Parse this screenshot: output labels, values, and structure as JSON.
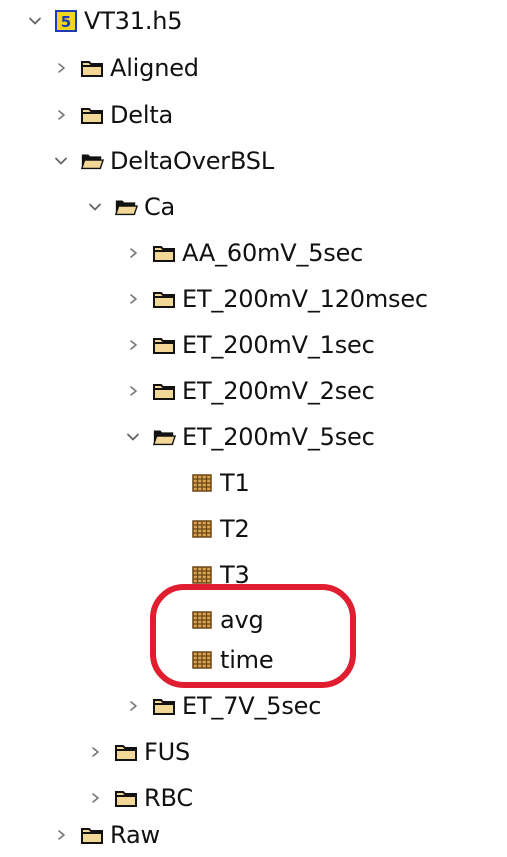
{
  "tree": {
    "root": {
      "label": "VT31.h5",
      "badge": "5",
      "expanded": true
    },
    "items": [
      {
        "label": "Aligned",
        "type": "folder",
        "expanded": false
      },
      {
        "label": "Delta",
        "type": "folder",
        "expanded": false
      },
      {
        "label": "DeltaOverBSL",
        "type": "folder",
        "expanded": true
      },
      {
        "label": "Ca",
        "type": "folder",
        "expanded": true
      },
      {
        "label": "AA_60mV_5sec",
        "type": "folder",
        "expanded": false
      },
      {
        "label": "ET_200mV_120msec",
        "type": "folder",
        "expanded": false
      },
      {
        "label": "ET_200mV_1sec",
        "type": "folder",
        "expanded": false
      },
      {
        "label": "ET_200mV_2sec",
        "type": "folder",
        "expanded": false
      },
      {
        "label": "ET_200mV_5sec",
        "type": "folder",
        "expanded": true
      },
      {
        "label": "T1",
        "type": "dataset"
      },
      {
        "label": "T2",
        "type": "dataset"
      },
      {
        "label": "T3",
        "type": "dataset"
      },
      {
        "label": "avg",
        "type": "dataset"
      },
      {
        "label": "time",
        "type": "dataset"
      },
      {
        "label": "ET_7V_5sec",
        "type": "folder",
        "expanded": false
      },
      {
        "label": "FUS",
        "type": "folder",
        "expanded": false
      },
      {
        "label": "RBC",
        "type": "folder",
        "expanded": false
      },
      {
        "label": "Raw",
        "type": "folder",
        "expanded": false
      }
    ]
  },
  "colors": {
    "folder_fill": "#f3d796",
    "folder_dark": "#121212",
    "dataset_fill": "#d9a34f",
    "dataset_grid": "#6a4516",
    "badge_fill": "#f2d423",
    "badge_text": "#1f3bb3",
    "highlight": "#e01e2f",
    "chevron": "#666666"
  }
}
